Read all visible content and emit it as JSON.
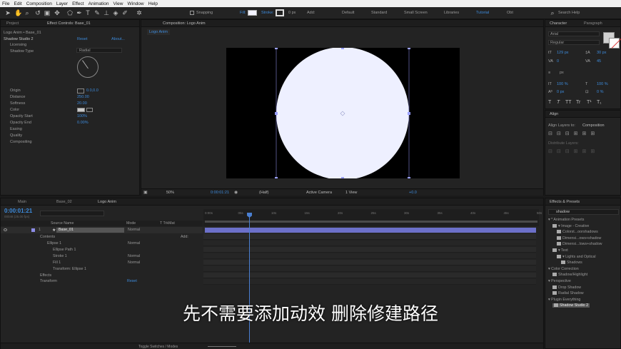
{
  "menu": [
    "File",
    "Edit",
    "Composition",
    "Layer",
    "Effect",
    "Animation",
    "View",
    "Window",
    "Help"
  ],
  "toolbar": {
    "snapping": "Snapping",
    "fill_label": "Fill:",
    "stroke_label": "Stroke:",
    "stroke_px": "0 px",
    "add_label": "Add:",
    "workspaces": [
      "Default",
      "Standard",
      "Small Screen",
      "Libraries",
      "Tutorial",
      "Obt"
    ],
    "search_help": "Search Help"
  },
  "left_panel": {
    "tab_project": "Project",
    "tab_effect_controls": "Effect Controls: Base_01",
    "breadcrumb": "Logo Anim • Base_01",
    "effect_name": "Shadow Studio 2",
    "reset": "Reset",
    "about": "About...",
    "licensing": "Licensing",
    "shadow_type_label": "Shadow Type",
    "shadow_type_value": "Radial",
    "origin_label": "Origin",
    "origin_value": "0.0,0.0",
    "distance_label": "Distance",
    "distance_value": "250.00",
    "softness_label": "Softness",
    "softness_value": "20.00",
    "color_label": "Color",
    "opacity_start_label": "Opacity Start",
    "opacity_start_value": "100%",
    "opacity_end_label": "Opacity End",
    "opacity_end_value": "0.00%",
    "easing": "Easing",
    "quality": "Quality",
    "compositing": "Compositing"
  },
  "composition": {
    "tab": "Composition: Logo Anim",
    "subtab": "Logo Anim",
    "canvas_color": "#000000",
    "circle_color": "#eef0ff",
    "zoom": "50%",
    "timecode": "0:00:01:21",
    "resolution": "(Half)",
    "camera": "Active Camera",
    "view": "1 View",
    "exposure": "+0.0"
  },
  "character": {
    "tab": "Character",
    "tab2": "Paragraph",
    "font": "Arial",
    "style": "Regular",
    "size": "129 px",
    "leading": "30 px",
    "kerning": "0",
    "tracking": "45",
    "stroke": "px",
    "vscale": "100 %",
    "hscale": "100 %",
    "baseline": "0 px",
    "tsume": "0 %",
    "styles": [
      "T",
      "T",
      "TT",
      "Tr",
      "T¹",
      "T₁"
    ]
  },
  "align": {
    "tab": "Align",
    "align_to_label": "Align Layers to:",
    "align_to_value": "Composition",
    "distribute_label": "Distribute Layers:"
  },
  "effects_presets": {
    "tab": "Effects & Presets",
    "search": "shadow",
    "items": [
      {
        "label": "▾ * Animation Presets",
        "indent": 0,
        "icon": false,
        "highlight": false
      },
      {
        "label": "▾ Image - Creative",
        "indent": 1,
        "icon": true,
        "highlight": false
      },
      {
        "label": "Colorst...oorshadows",
        "indent": 2,
        "icon": true,
        "highlight": false
      },
      {
        "label": "Dimensi...ows+shadow",
        "indent": 2,
        "icon": true,
        "highlight": false
      },
      {
        "label": "Dimensi...lows+shadow",
        "indent": 2,
        "icon": true,
        "highlight": false
      },
      {
        "label": "▾ Text",
        "indent": 1,
        "icon": true,
        "highlight": false
      },
      {
        "label": "▾ Lights and Optical",
        "indent": 2,
        "icon": true,
        "highlight": false
      },
      {
        "label": "Shadows",
        "indent": 3,
        "icon": true,
        "highlight": false
      },
      {
        "label": "▾ Color Correction",
        "indent": 0,
        "icon": false,
        "highlight": false
      },
      {
        "label": "Shadow/Highlight",
        "indent": 1,
        "icon": true,
        "highlight": false
      },
      {
        "label": "▾ Perspective",
        "indent": 0,
        "icon": false,
        "highlight": false
      },
      {
        "label": "Drop Shadow",
        "indent": 1,
        "icon": true,
        "highlight": false
      },
      {
        "label": "Radial Shadow",
        "indent": 1,
        "icon": true,
        "highlight": false
      },
      {
        "label": "▾ Plugin Everything",
        "indent": 0,
        "icon": false,
        "highlight": false
      },
      {
        "label": "Shadow Studio 2",
        "indent": 1,
        "icon": true,
        "highlight": true
      }
    ]
  },
  "timeline": {
    "tabs": [
      "Main",
      "Base_02",
      "Logo Anim"
    ],
    "timecode": "0:00:01:21",
    "timecode_sub": "00048 (25.00 fps)",
    "col_source": "Source Name",
    "col_mode": "Mode",
    "col_trkmat": "T TrkMat",
    "ruler": [
      "0:00s",
      "05s",
      "10s",
      "15s",
      "20s",
      "25s",
      "30s",
      "35s",
      "40s",
      "45s",
      "50s"
    ],
    "layer_num": "1",
    "layer_name": "Base_01",
    "layer_mode": "Normal",
    "add_label": "Add:",
    "contents": "Contents",
    "ellipse": "Ellipse 1",
    "ellipse_mode": "Normal",
    "ellipse_path": "Ellipse Path 1",
    "stroke": "Stroke 1",
    "stroke_mode": "Normal",
    "fill": "Fill 1",
    "fill_mode": "Normal",
    "transform_ellipse": "Transform: Ellipse 1",
    "effects": "Effects",
    "transform": "Transform",
    "reset": "Reset",
    "toggle": "Toggle Switches / Modes",
    "layer_bar_color": "#6c70c9"
  },
  "subtitle": "先不需要添加动效 删除修建路径"
}
